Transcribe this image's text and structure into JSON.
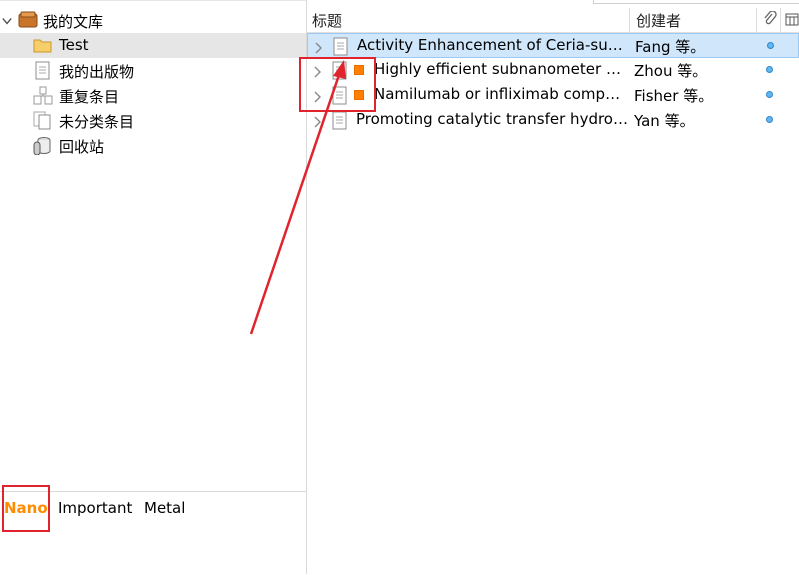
{
  "library": {
    "root_label": "我的文库",
    "items": [
      {
        "label": "Test"
      },
      {
        "label": "我的出版物"
      },
      {
        "label": "重复条目"
      },
      {
        "label": "未分类条目"
      },
      {
        "label": "回收站"
      }
    ]
  },
  "tags": [
    "Nano",
    "Important",
    "Metal"
  ],
  "table": {
    "headers": {
      "title": "标题",
      "creator": "创建者"
    },
    "rows": [
      {
        "title": "Activity Enhancement of Ceria-supported Pd Catalysts",
        "creator": "Fang 等。"
      },
      {
        "title": "Highly efficient subnanometer Ru catalysts",
        "creator": "Zhou 等。"
      },
      {
        "title": "Namilumab or infliximab compared with standard care",
        "creator": "Fisher 等。"
      },
      {
        "title": "Promoting catalytic transfer hydrogenation",
        "creator": "Yan 等。"
      }
    ]
  },
  "colors": {
    "tag_highlight": "#ff8c00",
    "annotation_red": "#e0242d",
    "selection": "#cfe6fb",
    "attachment_dot": "#63b6ee"
  }
}
